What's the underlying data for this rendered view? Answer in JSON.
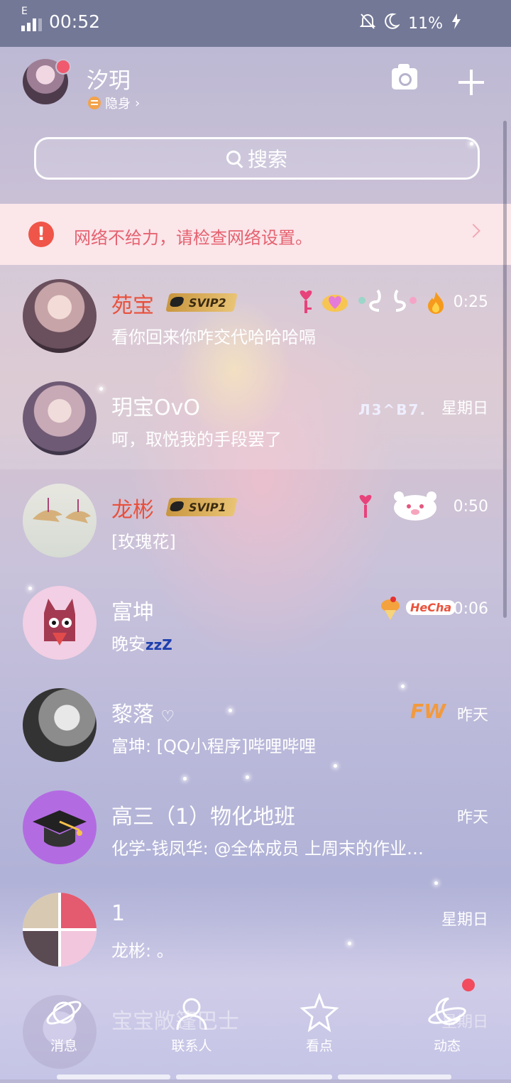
{
  "status_bar": {
    "carrier": "E",
    "time": "00:52",
    "battery": "11%",
    "icons": [
      "signal-icon",
      "mute-bell-icon",
      "moon-icon",
      "charging-icon"
    ]
  },
  "header": {
    "username": "汐玥",
    "status": "隐身",
    "icons": [
      "camera-icon",
      "plus-icon"
    ]
  },
  "search": {
    "placeholder": "搜索"
  },
  "network_banner": {
    "message": "网络不给力，请检查网络设置。"
  },
  "chats": [
    {
      "name": "苑宝",
      "vip": "SVIP2",
      "preview": "看你回来你咋交代哈哈哈嗝",
      "time": "0:25",
      "pinned": true
    },
    {
      "name": "玥宝OvO",
      "vip": "",
      "preview": "呵，取悦我的手段罢了",
      "time": "星期日",
      "pinned": true,
      "tag": "Л3^B7."
    },
    {
      "name": "龙彬",
      "vip": "SVIP1",
      "preview": "[玫瑰花]",
      "time": "0:50",
      "pinned": false
    },
    {
      "name": "富坤",
      "vip": "",
      "preview": "晚安",
      "preview_suffix": "zzZ",
      "time": "0:06",
      "pinned": false,
      "tag": "HeCha"
    },
    {
      "name": "黎落",
      "vip": "",
      "preview": "富坤: [QQ小程序]哔哩哔哩",
      "time": "昨天",
      "pinned": false,
      "tag": "FW"
    },
    {
      "name": "高三（1）物化地班",
      "vip": "",
      "preview": "化学-钱凤华: @全体成员 上周末的作业…",
      "time": "昨天",
      "pinned": false
    },
    {
      "name": "1",
      "vip": "",
      "preview": "龙彬: 。",
      "time": "星期日",
      "pinned": false
    },
    {
      "name": "宝宝敞篷巴士",
      "vip": "",
      "preview": "",
      "time": "星期日",
      "pinned": false
    }
  ],
  "tabs": [
    {
      "label": "消息",
      "icon": "planet-icon"
    },
    {
      "label": "联系人",
      "icon": "person-icon"
    },
    {
      "label": "看点",
      "icon": "star-icon"
    },
    {
      "label": "动态",
      "icon": "moon-ring-icon"
    }
  ],
  "colors": {
    "vip_name": "#e8503c",
    "warning": "#ef5548",
    "banner_bg": "#fbe6ea"
  }
}
